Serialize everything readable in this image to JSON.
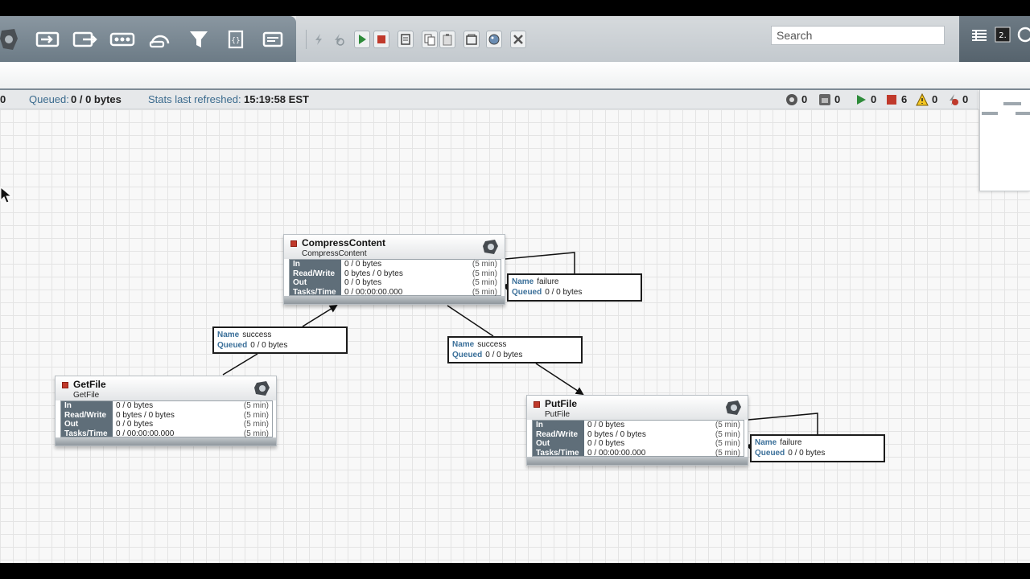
{
  "toolbar": {
    "search_placeholder": "Search",
    "component_icons": [
      "processor-icon",
      "input-port-icon",
      "output-port-icon",
      "process-group-icon",
      "remote-process-group-icon",
      "funnel-icon",
      "template-icon",
      "label-icon"
    ],
    "action_icons": [
      "enable-icon",
      "disable-icon",
      "start-icon",
      "stop-icon",
      "create-template-icon",
      "copy-icon",
      "paste-icon",
      "group-icon",
      "change-color-icon",
      "delete-icon"
    ]
  },
  "status": {
    "active_threads": "0",
    "queued_label": "Queued:",
    "queued_value": "0 / 0 bytes",
    "refreshed_label": "Stats last refreshed:",
    "refreshed_value": "15:19:58 EST",
    "counts": {
      "transmitting": "0",
      "not_transmitting": "0",
      "running": "0",
      "stopped": "6",
      "invalid": "0",
      "disabled": "0"
    }
  },
  "stat_labels": {
    "in": "In",
    "read_write": "Read/Write",
    "out": "Out",
    "tasks_time": "Tasks/Time",
    "period": "(5 min)"
  },
  "conn_labels": {
    "name": "Name",
    "queued": "Queued"
  },
  "processors": [
    {
      "name": "CompressContent",
      "type": "CompressContent",
      "in": "0 / 0 bytes",
      "read_write": "0 bytes / 0 bytes",
      "out": "0 / 0 bytes",
      "tasks_time": "0 / 00:00:00.000"
    },
    {
      "name": "GetFile",
      "type": "GetFile",
      "in": "0 / 0 bytes",
      "read_write": "0 bytes / 0 bytes",
      "out": "0 / 0 bytes",
      "tasks_time": "0 / 00:00:00.000"
    },
    {
      "name": "PutFile",
      "type": "PutFile",
      "in": "0 / 0 bytes",
      "read_write": "0 bytes / 0 bytes",
      "out": "0 / 0 bytes",
      "tasks_time": "0 / 00:00:00.000"
    }
  ],
  "connections": [
    {
      "name": "success",
      "queued": "0 / 0 bytes"
    },
    {
      "name": "failure",
      "queued": "0 / 0 bytes"
    },
    {
      "name": "success",
      "queued": "0 / 0 bytes"
    },
    {
      "name": "failure",
      "queued": "0 / 0 bytes"
    }
  ],
  "colors": {
    "toolbar_dark": "#7b8893",
    "stopped": "#c0392b",
    "running": "#2e8b3a",
    "label_blue": "#3a6f99"
  }
}
